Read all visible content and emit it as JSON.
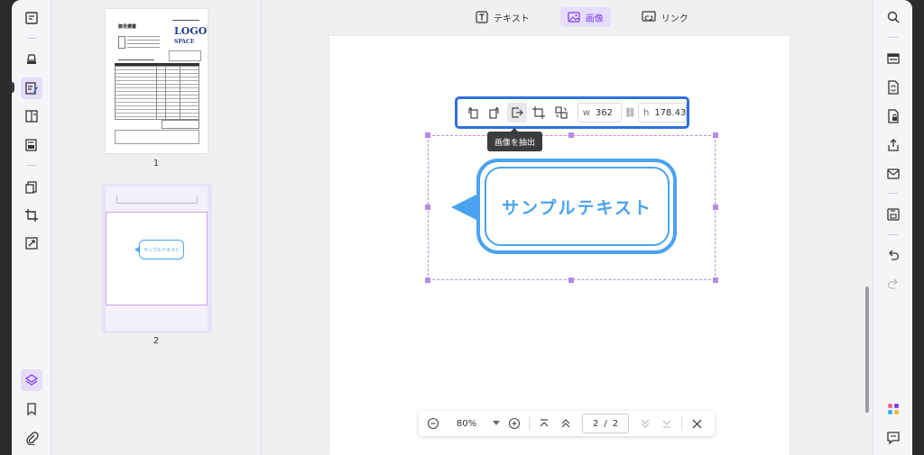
{
  "mode_tabs": [
    {
      "label": "テキスト",
      "icon": "text-icon"
    },
    {
      "label": "画像",
      "icon": "image-icon"
    },
    {
      "label": "リンク",
      "icon": "link-icon"
    }
  ],
  "thumbnails": [
    {
      "page": "1",
      "logo_line1": "LOGO",
      "logo_line2": "SPACE",
      "heading": "御見積書"
    },
    {
      "page": "2",
      "bubble_text": "サンプルテキスト"
    }
  ],
  "image_toolbar": {
    "width_label": "w",
    "width_value": "362",
    "height_label": "h",
    "height_value": "178.43",
    "tooltip": "画像を抽出"
  },
  "canvas": {
    "bubble_text": "サンプルテキスト"
  },
  "bottom_nav": {
    "zoom": "80%",
    "current_page": "2",
    "separator": "/",
    "total_pages": "2"
  },
  "colors": {
    "accent": "#7a3ff0",
    "selection": "#b48be8",
    "toolbar_border": "#2f6fe0",
    "bubble": "#4aa3f0"
  }
}
